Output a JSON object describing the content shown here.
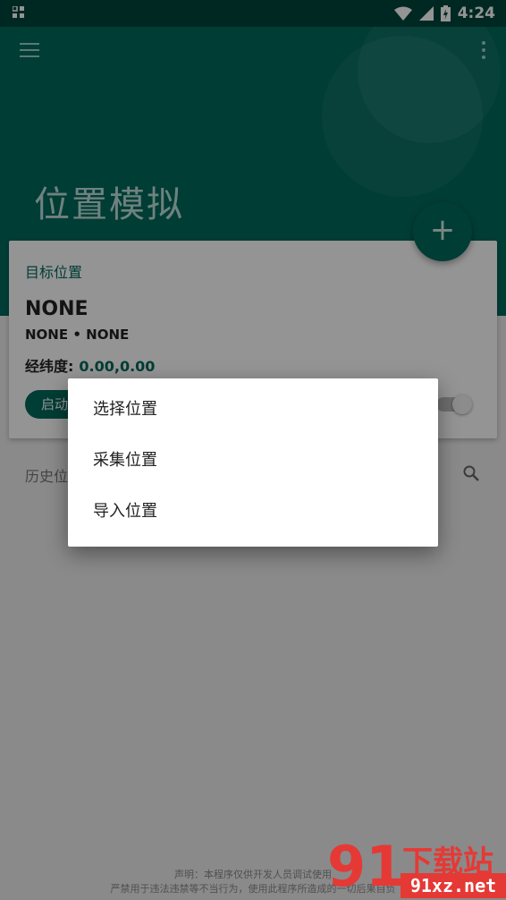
{
  "status_bar": {
    "time": "4:24",
    "icons": [
      "notification-icon",
      "wifi-icon",
      "signal-icon",
      "battery-charging-icon"
    ]
  },
  "app_bar": {
    "title": "位置模拟",
    "menu_icon": "menu-icon",
    "more_icon": "more-vert-icon",
    "fab_icon": "+"
  },
  "target_card": {
    "label": "目标位置",
    "name": "NONE",
    "subtitle": "NONE • NONE",
    "coord_label": "经纬度:",
    "coord_value": "0.00,0.00",
    "start_button": "启动"
  },
  "history": {
    "label": "历史位置"
  },
  "dialog": {
    "items": [
      "选择位置",
      "采集位置",
      "导入位置"
    ]
  },
  "footer": {
    "line1": "声明：本程序仅供开发人员调试使用",
    "line2": "严禁用于违法违禁等不当行为，使用此程序所造成的一切后果自负"
  },
  "watermark": {
    "logo": "91",
    "cn": "下载站",
    "url": "91xz.net"
  },
  "colors": {
    "primary": "#00695c",
    "status_bar": "#00463c",
    "watermark": "#e53935"
  }
}
